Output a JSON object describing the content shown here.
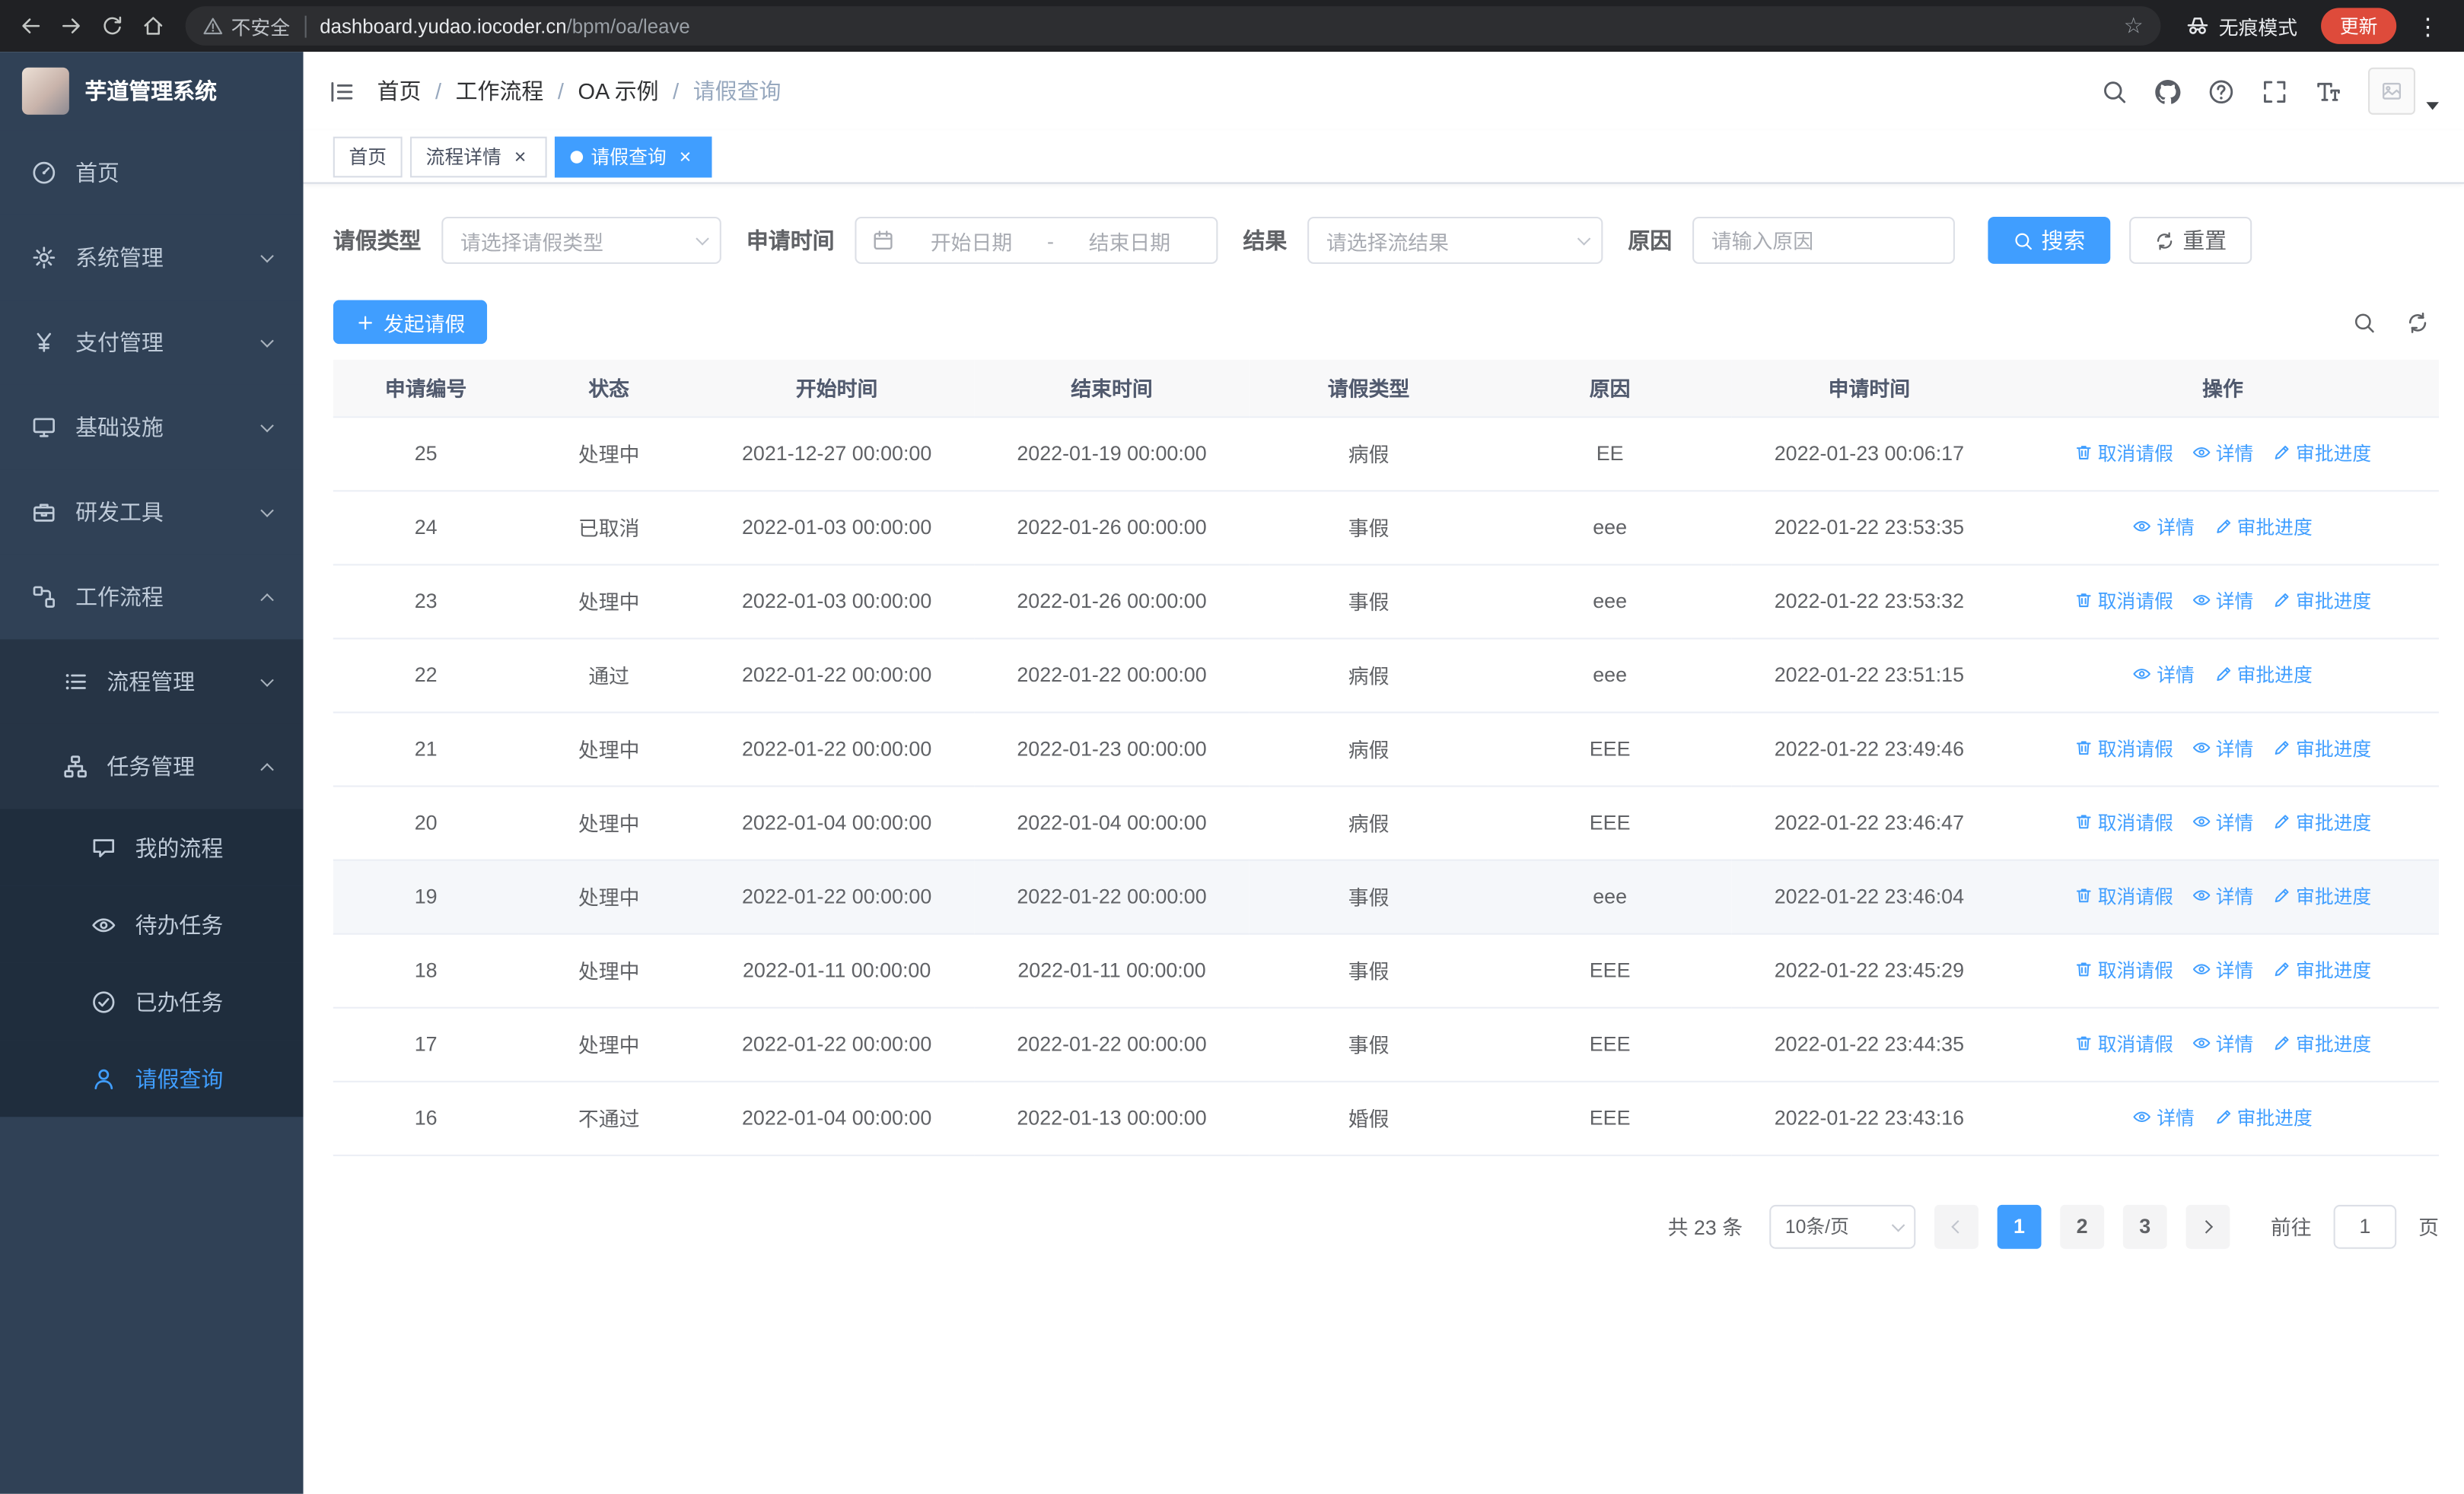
{
  "browser": {
    "security_label": "不安全",
    "url_host": "dashboard.yudao.iocoder.cn",
    "url_path": "/bpm/oa/leave",
    "incognito_label": "无痕模式",
    "update_label": "更新"
  },
  "sidebar": {
    "logo_title": "芋道管理系统",
    "items": [
      {
        "key": "home",
        "label": "首页",
        "icon": "dashboard-icon",
        "level": 1
      },
      {
        "key": "system",
        "label": "系统管理",
        "icon": "gear-icon",
        "level": 1,
        "chevron": "down"
      },
      {
        "key": "payment",
        "label": "支付管理",
        "icon": "yen-icon",
        "level": 1,
        "chevron": "down"
      },
      {
        "key": "infrastructure",
        "label": "基础设施",
        "icon": "monitor-icon",
        "level": 1,
        "chevron": "down"
      },
      {
        "key": "devtools",
        "label": "研发工具",
        "icon": "toolbox-icon",
        "level": 1,
        "chevron": "down"
      },
      {
        "key": "workflow",
        "label": "工作流程",
        "icon": "workflow-icon",
        "level": 1,
        "chevron": "up"
      },
      {
        "key": "process-mgmt",
        "label": "流程管理",
        "icon": "list-icon",
        "level": 2,
        "chevron": "down"
      },
      {
        "key": "task-mgmt",
        "label": "任务管理",
        "icon": "tree-icon",
        "level": 2,
        "chevron": "up"
      },
      {
        "key": "my-process",
        "label": "我的流程",
        "icon": "chat-icon",
        "level": 3
      },
      {
        "key": "todo-tasks",
        "label": "待办任务",
        "icon": "eye-icon",
        "level": 3
      },
      {
        "key": "done-tasks",
        "label": "已办任务",
        "icon": "check-circle-icon",
        "level": 3
      },
      {
        "key": "leave-query",
        "label": "请假查询",
        "icon": "user-icon",
        "level": 3,
        "active": true
      }
    ]
  },
  "header": {
    "breadcrumb": [
      "首页",
      "工作流程",
      "OA 示例",
      "请假查询"
    ]
  },
  "tabs": [
    {
      "label": "首页",
      "closable": false,
      "active": false
    },
    {
      "label": "流程详情",
      "closable": true,
      "active": false
    },
    {
      "label": "请假查询",
      "closable": true,
      "active": true
    }
  ],
  "filters": {
    "leave_type_label": "请假类型",
    "leave_type_placeholder": "请选择请假类型",
    "apply_time_label": "申请时间",
    "start_date_placeholder": "开始日期",
    "range_separator": "-",
    "end_date_placeholder": "结束日期",
    "result_label": "结果",
    "result_placeholder": "请选择流结果",
    "reason_label": "原因",
    "reason_placeholder": "请输入原因",
    "search_label": "搜索",
    "reset_label": "重置"
  },
  "toolbar": {
    "create_label": "发起请假"
  },
  "table": {
    "columns": [
      "申请编号",
      "状态",
      "开始时间",
      "结束时间",
      "请假类型",
      "原因",
      "申请时间",
      "操作"
    ],
    "action_labels": {
      "cancel": "取消请假",
      "detail": "详情",
      "progress": "审批进度"
    },
    "rows": [
      {
        "id": "25",
        "status": "处理中",
        "start": "2021-12-27 00:00:00",
        "end": "2022-01-19 00:00:00",
        "type": "病假",
        "reason": "EE",
        "applied": "2022-01-23 00:06:17",
        "actions": [
          "cancel",
          "detail",
          "progress"
        ]
      },
      {
        "id": "24",
        "status": "已取消",
        "start": "2022-01-03 00:00:00",
        "end": "2022-01-26 00:00:00",
        "type": "事假",
        "reason": "eee",
        "applied": "2022-01-22 23:53:35",
        "actions": [
          "detail",
          "progress"
        ]
      },
      {
        "id": "23",
        "status": "处理中",
        "start": "2022-01-03 00:00:00",
        "end": "2022-01-26 00:00:00",
        "type": "事假",
        "reason": "eee",
        "applied": "2022-01-22 23:53:32",
        "actions": [
          "cancel",
          "detail",
          "progress"
        ]
      },
      {
        "id": "22",
        "status": "通过",
        "start": "2022-01-22 00:00:00",
        "end": "2022-01-22 00:00:00",
        "type": "病假",
        "reason": "eee",
        "applied": "2022-01-22 23:51:15",
        "actions": [
          "detail",
          "progress"
        ]
      },
      {
        "id": "21",
        "status": "处理中",
        "start": "2022-01-22 00:00:00",
        "end": "2022-01-23 00:00:00",
        "type": "病假",
        "reason": "EEE",
        "applied": "2022-01-22 23:49:46",
        "actions": [
          "cancel",
          "detail",
          "progress"
        ]
      },
      {
        "id": "20",
        "status": "处理中",
        "start": "2022-01-04 00:00:00",
        "end": "2022-01-04 00:00:00",
        "type": "病假",
        "reason": "EEE",
        "applied": "2022-01-22 23:46:47",
        "actions": [
          "cancel",
          "detail",
          "progress"
        ]
      },
      {
        "id": "19",
        "status": "处理中",
        "start": "2022-01-22 00:00:00",
        "end": "2022-01-22 00:00:00",
        "type": "事假",
        "reason": "eee",
        "applied": "2022-01-22 23:46:04",
        "actions": [
          "cancel",
          "detail",
          "progress"
        ],
        "highlighted": true
      },
      {
        "id": "18",
        "status": "处理中",
        "start": "2022-01-11 00:00:00",
        "end": "2022-01-11 00:00:00",
        "type": "事假",
        "reason": "EEE",
        "applied": "2022-01-22 23:45:29",
        "actions": [
          "cancel",
          "detail",
          "progress"
        ]
      },
      {
        "id": "17",
        "status": "处理中",
        "start": "2022-01-22 00:00:00",
        "end": "2022-01-22 00:00:00",
        "type": "事假",
        "reason": "EEE",
        "applied": "2022-01-22 23:44:35",
        "actions": [
          "cancel",
          "detail",
          "progress"
        ]
      },
      {
        "id": "16",
        "status": "不通过",
        "start": "2022-01-04 00:00:00",
        "end": "2022-01-13 00:00:00",
        "type": "婚假",
        "reason": "EEE",
        "applied": "2022-01-22 23:43:16",
        "actions": [
          "detail",
          "progress"
        ]
      }
    ]
  },
  "pagination": {
    "total_label": "共 23 条",
    "page_size": "10条/页",
    "pages": [
      "1",
      "2",
      "3"
    ],
    "active_page": "1",
    "goto_label": "前往",
    "goto_value": "1",
    "page_unit": "页"
  }
}
